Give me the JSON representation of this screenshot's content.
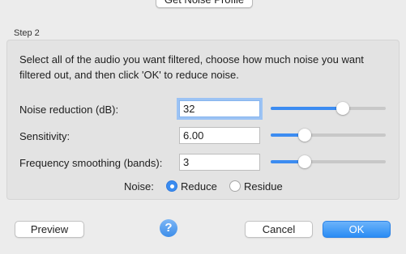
{
  "step1": {
    "button_label": "Get Noise Profile"
  },
  "step2": {
    "label": "Step 2",
    "description": "Select all of the audio you want filtered, choose how much noise you want filtered out, and then click 'OK' to reduce noise.",
    "noise_reduction": {
      "label": "Noise reduction (dB):",
      "value": "32",
      "slider_fraction": 0.64
    },
    "sensitivity": {
      "label": "Sensitivity:",
      "value": "6.00",
      "slider_fraction": 0.27
    },
    "frequency_smoothing": {
      "label": "Frequency smoothing (bands):",
      "value": "3",
      "slider_fraction": 0.27
    },
    "noise": {
      "label": "Noise:",
      "options": [
        {
          "label": "Reduce",
          "selected": true
        },
        {
          "label": "Residue",
          "selected": false
        }
      ]
    }
  },
  "footer": {
    "preview_label": "Preview",
    "help_glyph": "?",
    "cancel_label": "Cancel",
    "ok_label": "OK"
  },
  "colors": {
    "accent": "#3c8cf1",
    "background": "#ececec"
  },
  "icons": {
    "help": "help-icon"
  }
}
